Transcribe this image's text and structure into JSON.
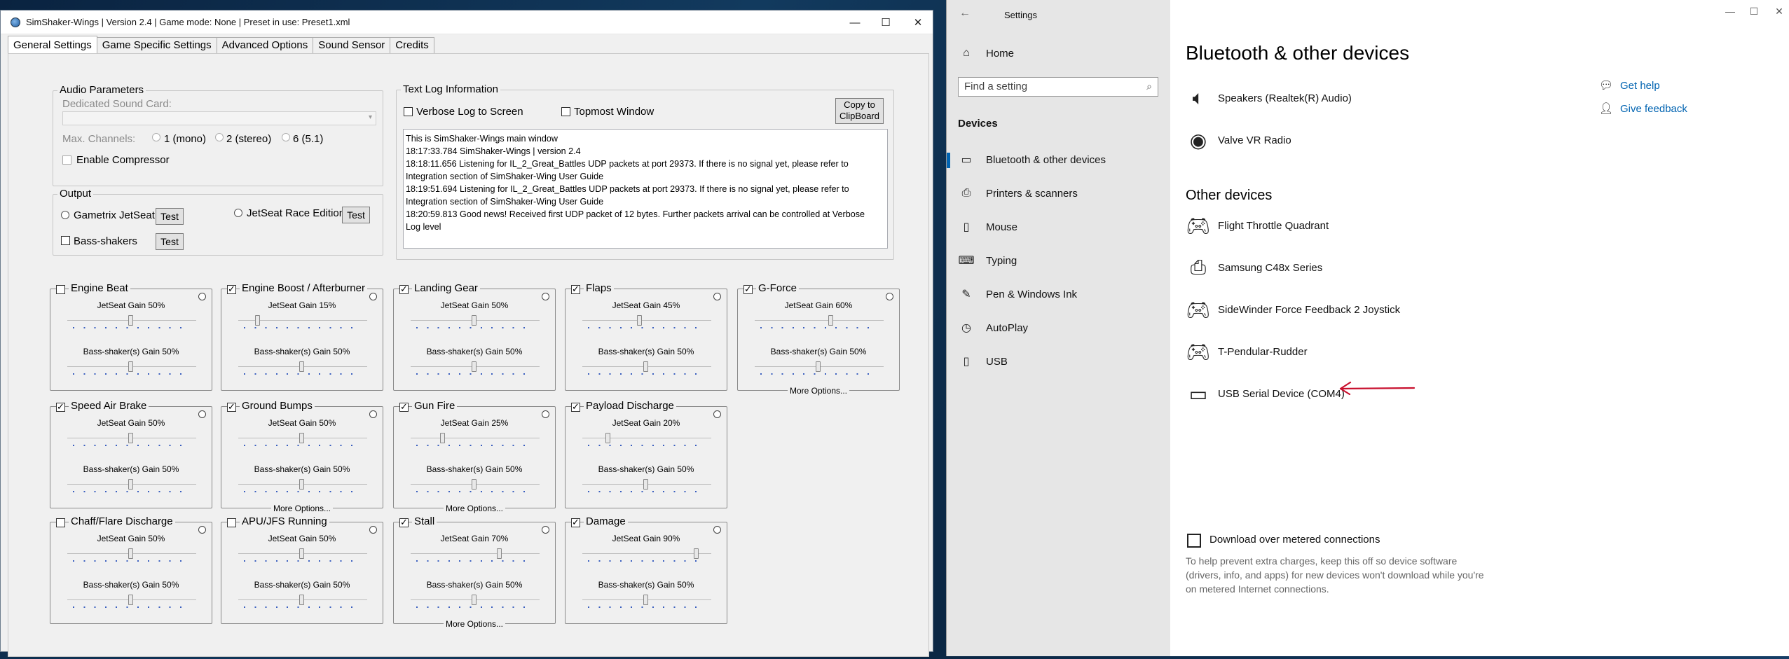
{
  "sim": {
    "title": "SimShaker-Wings | Version 2.4 | Game mode: None | Preset in use: Preset1.xml",
    "window": {
      "min": "—",
      "max": "☐",
      "close": "✕"
    },
    "tabs": [
      "General Settings",
      "Game Specific Settings",
      "Advanced Options",
      "Sound Sensor",
      "Credits"
    ],
    "audio": {
      "group": "Audio Parameters",
      "dedicated": "Dedicated Sound Card:",
      "max_channels": "Max. Channels:",
      "ch1": "1 (mono)",
      "ch2": "2 (stereo)",
      "ch3": "6 (5.1)",
      "compressor": "Enable Compressor"
    },
    "output": {
      "group": "Output",
      "gametrix": "Gametrix JetSeat",
      "jetseat_race": "JetSeat Race Edition",
      "bass": "Bass-shakers",
      "test": "Test"
    },
    "log": {
      "group": "Text Log Information",
      "verbose": "Verbose Log to Screen",
      "topmost": "Topmost Window",
      "copy1": "Copy to",
      "copy2": "ClipBoard",
      "lines": [
        "This is SimShaker-Wings main window",
        "18:17:33.784 SimShaker-Wings | version 2.4",
        "18:18:11.656 Listening for IL_2_Great_Battles UDP packets at port 29373. If there is no signal yet, please refer to",
        "Integration section of SimShaker-Wing User Guide",
        "18:19:51.694 Listening for IL_2_Great_Battles UDP packets at port 29373. If there is no signal yet, please refer to",
        "Integration section of SimShaker-Wing User Guide",
        "18:20:59.813 Good news! Received first UDP packet of 12 bytes. Further packets arrival can be controlled at Verbose",
        "Log level"
      ]
    },
    "effects": [
      {
        "name": "Engine Beat",
        "checked": false,
        "jet_label": "JetSeat Gain 50%",
        "jet": 0.5,
        "bass_label": "Bass-shaker(s) Gain 50%",
        "bass": 0.5,
        "more": ""
      },
      {
        "name": "Engine Boost / Afterburner",
        "checked": true,
        "jet_label": "JetSeat Gain 15%",
        "jet": 0.15,
        "bass_label": "Bass-shaker(s) Gain 50%",
        "bass": 0.5,
        "more": ""
      },
      {
        "name": "Landing Gear",
        "checked": true,
        "jet_label": "JetSeat Gain 50%",
        "jet": 0.5,
        "bass_label": "Bass-shaker(s) Gain 50%",
        "bass": 0.5,
        "more": ""
      },
      {
        "name": "Flaps",
        "checked": true,
        "jet_label": "JetSeat Gain 45%",
        "jet": 0.45,
        "bass_label": "Bass-shaker(s) Gain 50%",
        "bass": 0.5,
        "more": ""
      },
      {
        "name": "G-Force",
        "checked": true,
        "jet_label": "JetSeat Gain 60%",
        "jet": 0.6,
        "bass_label": "Bass-shaker(s) Gain 50%",
        "bass": 0.5,
        "more": "More Options..."
      },
      {
        "name": "Speed Air Brake",
        "checked": true,
        "jet_label": "JetSeat Gain 50%",
        "jet": 0.5,
        "bass_label": "Bass-shaker(s) Gain 50%",
        "bass": 0.5,
        "more": ""
      },
      {
        "name": "Ground Bumps",
        "checked": true,
        "jet_label": "JetSeat Gain 50%",
        "jet": 0.5,
        "bass_label": "Bass-shaker(s) Gain 50%",
        "bass": 0.5,
        "more": "More Options..."
      },
      {
        "name": "Gun Fire",
        "checked": true,
        "jet_label": "JetSeat Gain 25%",
        "jet": 0.25,
        "bass_label": "Bass-shaker(s) Gain 50%",
        "bass": 0.5,
        "more": "More Options..."
      },
      {
        "name": "Payload Discharge",
        "checked": true,
        "jet_label": "JetSeat Gain 20%",
        "jet": 0.2,
        "bass_label": "Bass-shaker(s) Gain 50%",
        "bass": 0.5,
        "more": ""
      },
      {
        "name": "Chaff/Flare Discharge",
        "checked": false,
        "jet_label": "JetSeat Gain 50%",
        "jet": 0.5,
        "bass_label": "Bass-shaker(s) Gain 50%",
        "bass": 0.5,
        "more": ""
      },
      {
        "name": "APU/JFS Running",
        "checked": false,
        "jet_label": "JetSeat Gain 50%",
        "jet": 0.5,
        "bass_label": "Bass-shaker(s) Gain 50%",
        "bass": 0.5,
        "more": ""
      },
      {
        "name": "Stall",
        "checked": true,
        "jet_label": "JetSeat Gain 70%",
        "jet": 0.7,
        "bass_label": "Bass-shaker(s) Gain 50%",
        "bass": 0.5,
        "more": "More Options..."
      },
      {
        "name": "Damage",
        "checked": true,
        "jet_label": "JetSeat Gain 90%",
        "jet": 0.9,
        "bass_label": "Bass-shaker(s) Gain 50%",
        "bass": 0.5,
        "more": ""
      }
    ]
  },
  "settings": {
    "title": "Settings",
    "back": "←",
    "home": "Home",
    "search_placeholder": "Find a setting",
    "section": "Devices",
    "nav": [
      {
        "label": "Bluetooth & other devices",
        "icon": "bluetooth-icon"
      },
      {
        "label": "Printers & scanners",
        "icon": "printer-icon"
      },
      {
        "label": "Mouse",
        "icon": "mouse-icon"
      },
      {
        "label": "Typing",
        "icon": "keyboard-icon"
      },
      {
        "label": "Pen & Windows Ink",
        "icon": "pen-icon"
      },
      {
        "label": "AutoPlay",
        "icon": "autoplay-icon"
      },
      {
        "label": "USB",
        "icon": "usb-icon"
      }
    ],
    "page_title": "Bluetooth & other devices",
    "audio_devices": [
      "Speakers (Realtek(R) Audio)",
      "Valve VR Radio"
    ],
    "other_title": "Other devices",
    "other_devices": [
      {
        "label": "Flight Throttle Quadrant",
        "icon": "gamepad-icon"
      },
      {
        "label": "Samsung C48x Series",
        "icon": "printer-icon"
      },
      {
        "label": "SideWinder Force Feedback 2 Joystick",
        "icon": "gamepad-icon"
      },
      {
        "label": "T-Pendular-Rudder",
        "icon": "gamepad-icon"
      },
      {
        "label": "USB Serial Device (COM4)",
        "icon": "serial-device-icon"
      }
    ],
    "get_help": "Get help",
    "give_feedback": "Give feedback",
    "download_label": "Download over metered connections",
    "download_desc": "To help prevent extra charges, keep this off so device software (drivers, info, and apps) for new devices won't download while you're on metered Internet connections.",
    "annotation_color": "#c8102e"
  }
}
